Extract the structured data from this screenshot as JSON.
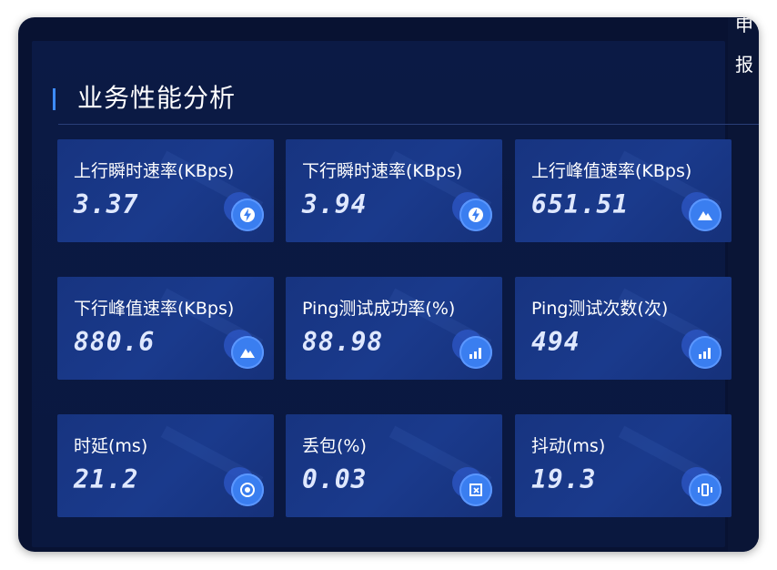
{
  "panel": {
    "title": "业务性能分析"
  },
  "side": {
    "line1": "申",
    "line2": "报"
  },
  "metrics": [
    {
      "label": "上行瞬时速率(KBps)",
      "value": "3.37",
      "icon": "lightning-icon"
    },
    {
      "label": "下行瞬时速率(KBps)",
      "value": "3.94",
      "icon": "lightning-icon"
    },
    {
      "label": "上行峰值速率(KBps)",
      "value": "651.51",
      "icon": "mountain-icon"
    },
    {
      "label": "下行峰值速率(KBps)",
      "value": "880.6",
      "icon": "mountain-icon"
    },
    {
      "label": "Ping测试成功率(%)",
      "value": "88.98",
      "icon": "signal-bars-icon"
    },
    {
      "label": "Ping测试次数(次)",
      "value": "494",
      "icon": "signal-bars-icon"
    },
    {
      "label": "时延(ms)",
      "value": "21.2",
      "icon": "clock-icon"
    },
    {
      "label": "丢包(%)",
      "value": "0.03",
      "icon": "packet-loss-icon"
    },
    {
      "label": "抖动(ms)",
      "value": "19.3",
      "icon": "vibrate-icon"
    }
  ],
  "colors": {
    "accent": "#3d8bff",
    "card": "#1a3a8c",
    "background": "#081232"
  }
}
